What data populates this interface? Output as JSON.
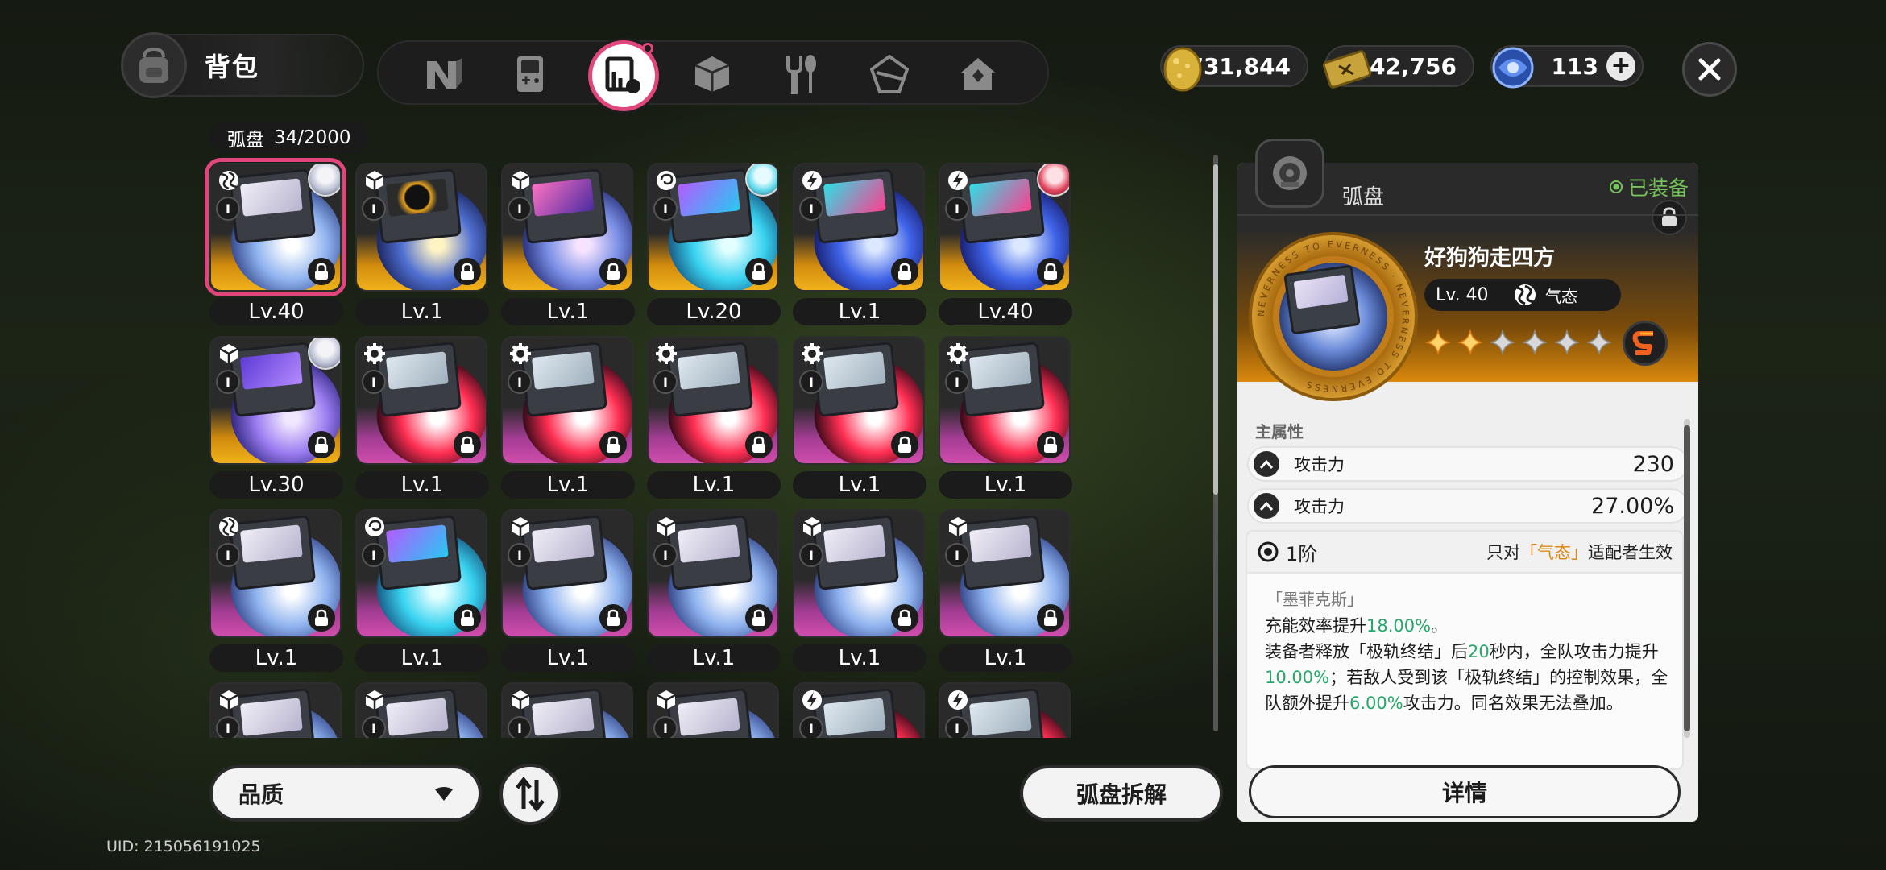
{
  "header": {
    "title": "背包",
    "categories": [
      {
        "icon": "n-logo-icon"
      },
      {
        "icon": "gameboy-icon"
      },
      {
        "icon": "arc-disc-icon",
        "active": true
      },
      {
        "icon": "cube-icon"
      },
      {
        "icon": "fork-spoon-icon"
      },
      {
        "icon": "crystal-icon"
      },
      {
        "icon": "home-icon"
      }
    ]
  },
  "currencies": [
    {
      "icon": "gold-egg-icon",
      "value": "731,844"
    },
    {
      "icon": "ticket-icon",
      "value": "542,756"
    },
    {
      "icon": "blue-orb-icon",
      "value": "113"
    }
  ],
  "inventory": {
    "label": "弧盘",
    "count": "34/2000",
    "items": [
      {
        "lv": "Lv.40",
        "rarity": "gold",
        "attr": "vortex",
        "avatar": "silver",
        "tone": "white",
        "selected": true
      },
      {
        "lv": "Lv.1",
        "rarity": "gold",
        "attr": "cube",
        "tone": "eclipse"
      },
      {
        "lv": "Lv.1",
        "rarity": "gold",
        "attr": "cube",
        "tone": "pink"
      },
      {
        "lv": "Lv.20",
        "rarity": "gold",
        "attr": "swirl",
        "avatar": "teal",
        "tone": "cyan"
      },
      {
        "lv": "Lv.1",
        "rarity": "gold",
        "attr": "bolt",
        "tone": "blue"
      },
      {
        "lv": "Lv.40",
        "rarity": "gold",
        "attr": "bolt",
        "avatar": "red",
        "tone": "blue"
      },
      {
        "lv": "Lv.30",
        "rarity": "gold",
        "attr": "cube",
        "avatar": "silver",
        "tone": "violet"
      },
      {
        "lv": "Lv.1",
        "rarity": "purple",
        "attr": "gear",
        "tone": "red"
      },
      {
        "lv": "Lv.1",
        "rarity": "purple",
        "attr": "gear",
        "tone": "red"
      },
      {
        "lv": "Lv.1",
        "rarity": "purple",
        "attr": "gear",
        "tone": "red"
      },
      {
        "lv": "Lv.1",
        "rarity": "purple",
        "attr": "gear",
        "tone": "red"
      },
      {
        "lv": "Lv.1",
        "rarity": "purple",
        "attr": "gear",
        "tone": "red"
      },
      {
        "lv": "Lv.1",
        "rarity": "purple",
        "attr": "vortex",
        "tone": "white"
      },
      {
        "lv": "Lv.1",
        "rarity": "purple",
        "attr": "swirl",
        "tone": "cyan"
      },
      {
        "lv": "Lv.1",
        "rarity": "purple",
        "attr": "cube",
        "tone": "white"
      },
      {
        "lv": "Lv.1",
        "rarity": "purple",
        "attr": "cube",
        "tone": "white"
      },
      {
        "lv": "Lv.1",
        "rarity": "purple",
        "attr": "cube",
        "tone": "white"
      },
      {
        "lv": "Lv.1",
        "rarity": "purple",
        "attr": "cube",
        "tone": "white"
      },
      {
        "lv": "",
        "rarity": "purple",
        "attr": "cube",
        "tone": "white"
      },
      {
        "lv": "",
        "rarity": "purple",
        "attr": "cube",
        "tone": "white"
      },
      {
        "lv": "",
        "rarity": "purple",
        "attr": "cube",
        "tone": "white"
      },
      {
        "lv": "",
        "rarity": "purple",
        "attr": "cube",
        "tone": "white"
      },
      {
        "lv": "",
        "rarity": "purple",
        "attr": "bolt",
        "tone": "red"
      },
      {
        "lv": "",
        "rarity": "purple",
        "attr": "bolt",
        "tone": "red"
      }
    ]
  },
  "controls": {
    "quality": "品质",
    "decompose": "弧盘拆解"
  },
  "uid": "UID: 215056191025",
  "detail": {
    "type": "弧盘",
    "status": "已装备",
    "name": "好狗狗走四方",
    "level": "Lv. 40",
    "attribute": "气态",
    "stars_filled": 2,
    "stars_total": 6,
    "rank": "S",
    "ring_text": "NEVERNESS TO EVERNESS",
    "main_attr_title": "主属性",
    "stats": [
      {
        "name": "攻击力",
        "value": "230"
      },
      {
        "name": "攻击力",
        "value": "27.00%"
      }
    ],
    "effect": {
      "tier": "1阶",
      "scope_prefix": "只对",
      "scope_attr": "「气态」",
      "scope_suffix": "适配者生效",
      "set_name": "「墨菲克斯」",
      "line1_a": "充能效率提升",
      "line1_v": "18.00%",
      "line1_b": "。",
      "line2_a": "装备者释放「极轨终结」后",
      "line2_v1": "20",
      "line2_b": "秒内，全队攻击力提升",
      "line2_v2": "10.00%",
      "line2_c": "；若敌人受到该「极轨终结」的控制效果，全队额外提升",
      "line2_v3": "6.00%",
      "line2_d": "攻击力。同名效果无法叠加。"
    },
    "detail_button": "详情"
  }
}
